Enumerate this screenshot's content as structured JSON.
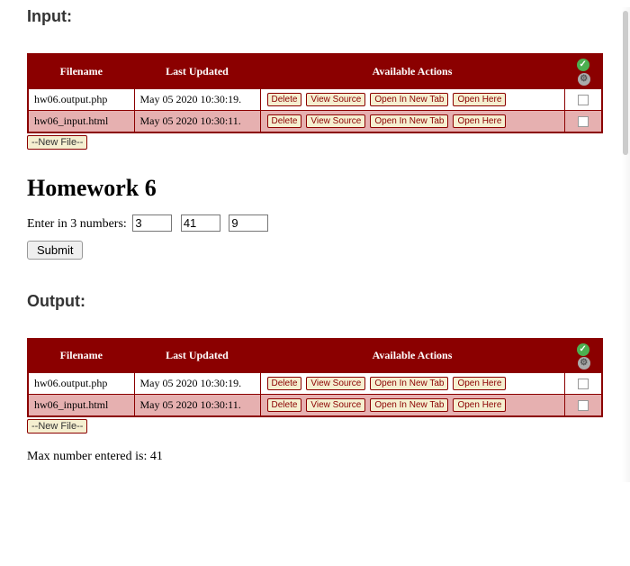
{
  "labels": {
    "input_section": "Input:",
    "output_section": "Output:",
    "new_file_btn": "--New File--"
  },
  "table": {
    "headers": {
      "filename": "Filename",
      "updated": "Last Updated",
      "actions": "Available Actions"
    },
    "actions": {
      "delete": "Delete",
      "view_source": "View Source",
      "open_new_tab": "Open In New Tab",
      "open_here": "Open Here"
    },
    "rows": [
      {
        "filename": "hw06.output.php",
        "updated": "May 05 2020 10:30:19."
      },
      {
        "filename": "hw06_input.html",
        "updated": "May 05 2020 10:30:11."
      }
    ]
  },
  "homework": {
    "title": "Homework 6",
    "prompt": "Enter in 3 numbers:",
    "values": {
      "a": "3",
      "b": "41",
      "c": "9"
    },
    "submit": "Submit"
  },
  "result": {
    "text": "Max number entered is: 41"
  }
}
